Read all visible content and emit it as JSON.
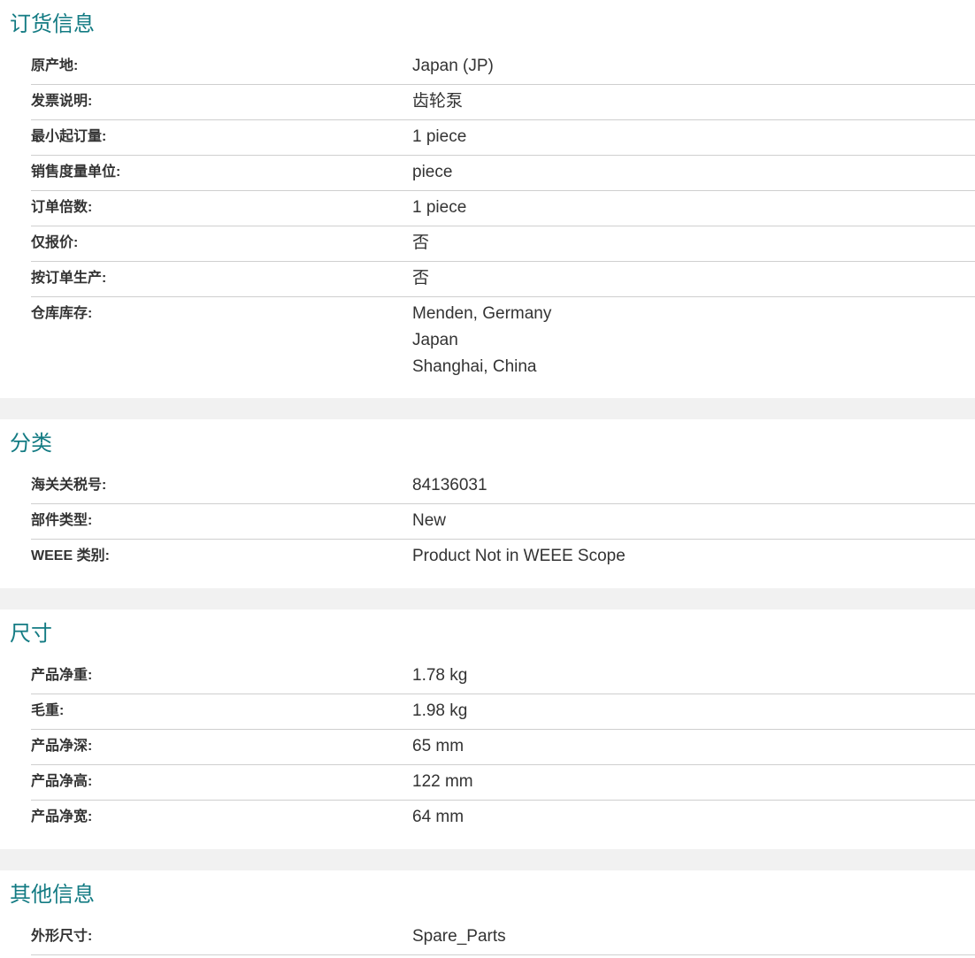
{
  "ordering": {
    "title": "订货信息",
    "rows": [
      {
        "label": "原产地:",
        "value": "Japan (JP)"
      },
      {
        "label": "发票说明:",
        "value": "齿轮泵"
      },
      {
        "label": "最小起订量:",
        "value": "1 piece"
      },
      {
        "label": "销售度量单位:",
        "value": "piece"
      },
      {
        "label": "订单倍数:",
        "value": "1 piece"
      },
      {
        "label": "仅报价:",
        "value": "否"
      },
      {
        "label": "按订单生产:",
        "value": "否"
      }
    ],
    "stock": {
      "label": "仓库库存:",
      "values": [
        "Menden, Germany",
        "Japan",
        "Shanghai, China"
      ]
    }
  },
  "classification": {
    "title": "分类",
    "rows": [
      {
        "label": "海关关税号:",
        "value": "84136031"
      },
      {
        "label": "部件类型:",
        "value": "New"
      },
      {
        "label": "WEEE 类别:",
        "value": "Product Not in WEEE Scope"
      }
    ]
  },
  "dimensions": {
    "title": "尺寸",
    "rows": [
      {
        "label": "产品净重:",
        "value": "1.78 kg"
      },
      {
        "label": "毛重:",
        "value": "1.98 kg"
      },
      {
        "label": "产品净深:",
        "value": "65 mm"
      },
      {
        "label": "产品净高:",
        "value": "122 mm"
      },
      {
        "label": "产品净宽:",
        "value": "64 mm"
      }
    ]
  },
  "other": {
    "title": "其他信息",
    "rows": [
      {
        "label": "外形尺寸:",
        "value": "Spare_Parts"
      }
    ]
  }
}
